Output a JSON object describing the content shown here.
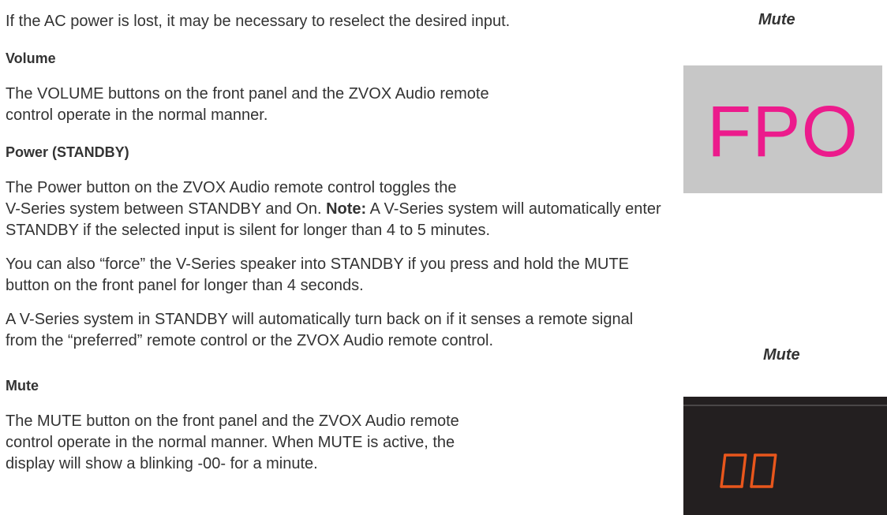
{
  "document": {
    "intro": "If the AC power is lost, it may be necessary to reselect the desired input.",
    "sections": {
      "volume": {
        "heading": "Volume",
        "line1": "The VOLUME buttons on the front panel and the ZVOX Audio remote",
        "line2": "control operate in the normal manner."
      },
      "power": {
        "heading": "Power (STANDBY)",
        "p1_line1": "The Power button on the ZVOX Audio remote control toggles the",
        "p1_line2_a": "V-Series system between STANDBY and On. ",
        "p1_note_label": "Note:",
        "p1_line2_b": " A V-Series system will automatically enter",
        "p1_line3": "STANDBY if the selected input is silent for longer than 4 to 5 minutes.",
        "p2_line1": "You can also “force” the V-Series speaker into STANDBY if you press and hold the MUTE",
        "p2_line2": "button on the front panel for longer than 4 seconds.",
        "p3_line1": "A V-Series system in STANDBY will automatically turn back on if it senses a remote signal",
        "p3_line2": "from the “preferred” remote control or the ZVOX Audio remote control."
      },
      "mute": {
        "heading": "Mute",
        "line1": "The MUTE button on the front panel and the ZVOX Audio remote",
        "line2": "control operate in the normal manner. When MUTE is active, the",
        "line3": "display will show a blinking -00- for a minute."
      }
    }
  },
  "figures": {
    "top": {
      "caption": "Mute",
      "placeholder_text": "FPO",
      "placeholder_bg": "#c7c7c7",
      "placeholder_color": "#ec1b8c"
    },
    "bottom": {
      "caption": "Mute",
      "display_digits": "00",
      "display_bg": "#231f20",
      "segment_color": "#e8561c"
    }
  }
}
